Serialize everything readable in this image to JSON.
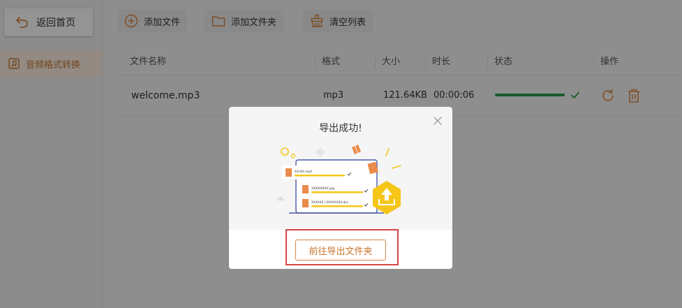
{
  "sidebar": {
    "back_label": "返回首页",
    "active_item": "音频格式转换"
  },
  "toolbar": {
    "add_file": "添加文件",
    "add_folder": "添加文件夹",
    "clear_list": "清空列表"
  },
  "table": {
    "headers": {
      "name": "文件名称",
      "format": "格式",
      "size": "大小",
      "duration": "时长",
      "status": "状态",
      "actions": "操作"
    },
    "rows": [
      {
        "name": "welcome.mp3",
        "format": "mp3",
        "size": "121.64KB",
        "duration": "00:00:06",
        "progress": 1.0
      }
    ]
  },
  "modal": {
    "title": "导出成功!",
    "button": "前往导出文件夹",
    "illustration_files": [
      "XX-XX.mp4",
      "XXXXXXXX.jpg",
      "XXXXXX | XXXXXXXX.doc"
    ]
  },
  "colors": {
    "accent": "#d98541",
    "success": "#2a9d4b",
    "highlight": "#d64545",
    "illustration_yellow": "#f5c518"
  }
}
